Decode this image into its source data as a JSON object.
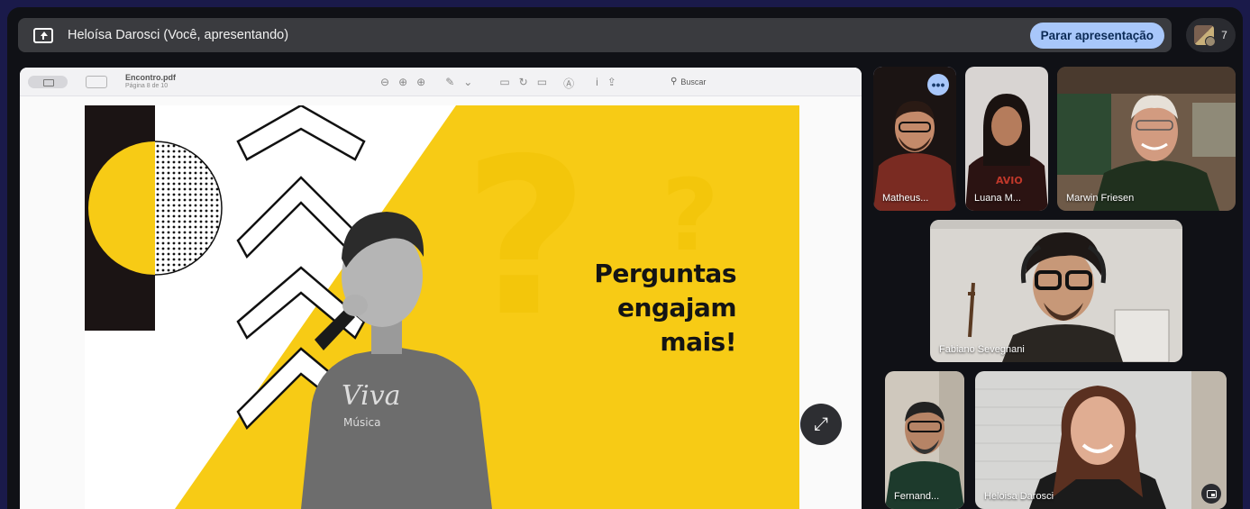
{
  "topbar": {
    "presenter_label": "Heloísa Darosci (Você, apresentando)",
    "stop_button": "Parar apresentação",
    "participant_count": "7"
  },
  "viewer": {
    "file_name": "Encontro.pdf",
    "page_info": "Página 8 de 10",
    "search_label": "Buscar"
  },
  "slide": {
    "headline_1": "Perguntas",
    "headline_2": "engajam",
    "headline_3": "mais!",
    "shirt_text": "Viva",
    "shirt_sub": "Música",
    "accent_color": "#f7cb15"
  },
  "participants": [
    {
      "name": "Matheus...",
      "speaking": true
    },
    {
      "name": "Luana M..."
    },
    {
      "name": "Marwin Friesen"
    },
    {
      "name": "Fabiano Sevegnani"
    },
    {
      "name": "Fernand..."
    },
    {
      "name": "Heloisa Darosci"
    }
  ],
  "icons": [
    "present-screen-icon",
    "more-options-icon",
    "expand-icon",
    "pip-icon",
    "search-icon"
  ]
}
